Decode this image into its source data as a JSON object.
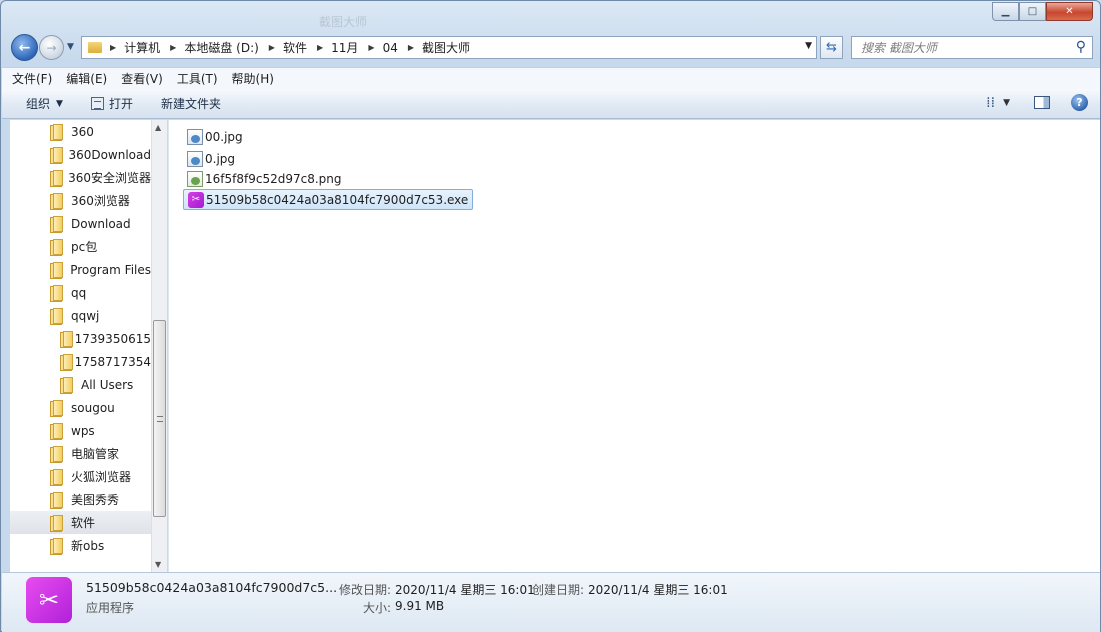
{
  "window": {
    "title": "截图大师",
    "controls": {
      "minimize": "▁",
      "maximize": "□",
      "close": "✕"
    }
  },
  "nav": {
    "back_icon": "back-arrow-icon",
    "forward_icon": "forward-arrow-icon",
    "breadcrumbs": [
      "计算机",
      "本地磁盘 (D:)",
      "软件",
      "11月",
      "04",
      "截图大师"
    ]
  },
  "search": {
    "placeholder": "搜索 截图大师"
  },
  "menu": [
    "文件(F)",
    "编辑(E)",
    "查看(V)",
    "工具(T)",
    "帮助(H)"
  ],
  "toolbar": {
    "organize": "组织",
    "open": "打开",
    "new_folder": "新建文件夹"
  },
  "tree": [
    {
      "label": "360",
      "indent": 0
    },
    {
      "label": "360Download",
      "indent": 0
    },
    {
      "label": "360安全浏览器",
      "indent": 0
    },
    {
      "label": "360浏览器",
      "indent": 0
    },
    {
      "label": "Download",
      "indent": 0
    },
    {
      "label": "pc包",
      "indent": 0
    },
    {
      "label": "Program Files",
      "indent": 0
    },
    {
      "label": "qq",
      "indent": 0
    },
    {
      "label": "qqwj",
      "indent": 0
    },
    {
      "label": "1739350615",
      "indent": 1
    },
    {
      "label": "1758717354",
      "indent": 1
    },
    {
      "label": "All Users",
      "indent": 1
    },
    {
      "label": "sougou",
      "indent": 0
    },
    {
      "label": "wps",
      "indent": 0
    },
    {
      "label": "电脑管家",
      "indent": 0
    },
    {
      "label": "火狐浏览器",
      "indent": 0
    },
    {
      "label": "美图秀秀",
      "indent": 0
    },
    {
      "label": "软件",
      "indent": 0,
      "selected": true
    },
    {
      "label": "新obs",
      "indent": 0
    }
  ],
  "files": [
    {
      "name": "00.jpg",
      "type": "jpg"
    },
    {
      "name": "0.jpg",
      "type": "jpg"
    },
    {
      "name": "16f5f8f9c52d97c8.png",
      "type": "png"
    },
    {
      "name": "51509b58c0424a03a8104fc7900d7c53.exe",
      "type": "exe",
      "selected": true
    }
  ],
  "details": {
    "name": "51509b58c0424a03a8104fc7900d7c5...",
    "type": "应用程序",
    "modified_label": "修改日期:",
    "modified_value": "2020/11/4 星期三 16:01",
    "created_label": "创建日期:",
    "created_value": "2020/11/4 星期三 16:01",
    "size_label": "大小:",
    "size_value": "9.91 MB"
  },
  "colors": {
    "selection": "#cfe5fa",
    "exe_icon": "#b021d8",
    "toolbar": "#dde8f3"
  }
}
